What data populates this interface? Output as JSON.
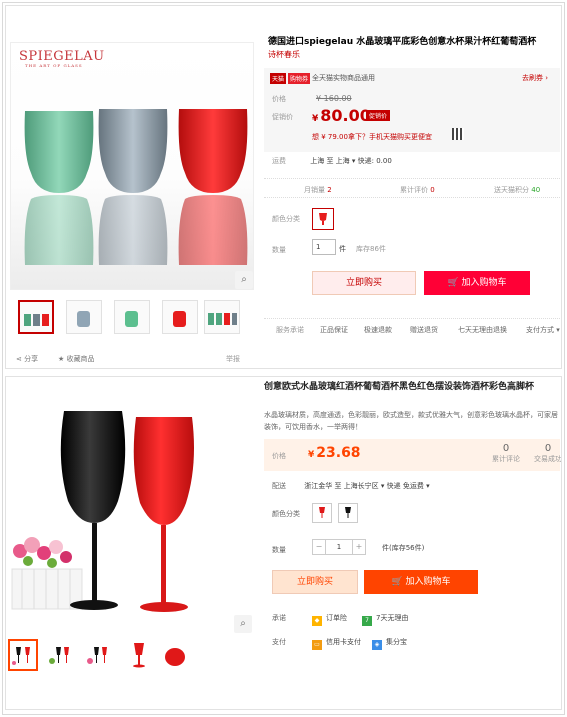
{
  "panel1": {
    "logo": "SPIEGELAU",
    "logo_sub": "THE ART OF GLASS",
    "title": "德国进口spiegelau 水晶玻璃平底彩色创意水杯果汁杯红葡萄酒杯",
    "subtitle": "诗杯春乐",
    "badges": {
      "tmall": "天猫",
      "shop": "购物券"
    },
    "shop_note": "全天猫实物商品通用",
    "coupon_link": "去刷券",
    "price_label": "价格",
    "old_price": "¥ 160.00",
    "promo_label": "促销价",
    "promo_currency": "¥",
    "promo_price": "80.00",
    "promo_tag": "促销价",
    "phone_note": "想 ¥ 79.00拿下？手机天猫购买更便宜",
    "shipping_label": "运费",
    "shipping_text": "上海  至 上海 ▾  快递: 0.00",
    "stats": [
      {
        "label": "月销量",
        "value": "2"
      },
      {
        "label": "累计评价",
        "value": "0"
      },
      {
        "label": "送天猫积分",
        "value": "40"
      }
    ],
    "color_label": "颜色分类",
    "qty_label": "数量",
    "qty_value": "1",
    "qty_unit": "件",
    "stock": "库存86件",
    "buy_label": "立即购买",
    "cart_label": "加入购物车",
    "service_label": "服务承诺",
    "services": [
      "正品保证",
      "极速退款",
      "赠送退货",
      "七天无理由退换"
    ],
    "pay_label": "支付方式 ▾",
    "share_label": "分享",
    "fav_label": "收藏商品",
    "report_label": "举报",
    "colors": {
      "green": "#4fa57f",
      "grey": "#6f7f8a",
      "red": "#e61d1d",
      "accent": "#c40000"
    }
  },
  "panel2": {
    "title": "创意欧式水晶玻璃红酒杯葡萄酒杯黑色红色摆设装饰酒杯彩色高脚杯",
    "desc": "水晶玻璃材质，高度通透，色彩靓丽，欧式造型，款式优雅大气，创意彩色玻璃水晶杯，可家居装饰，可饮用香水，一举两得！",
    "price_label": "价格",
    "currency": "¥",
    "price": "23.68",
    "reviews": {
      "value": "0",
      "label": "累计评论"
    },
    "sales": {
      "value": "0",
      "label": "交易成功"
    },
    "ship_label": "配送",
    "ship_text": "浙江金华 至  上海长宁区 ▾   快递 免运费 ▾",
    "color_label": "颜色分类",
    "qty_label": "数量",
    "qty_value": "1",
    "minus": "−",
    "plus": "+",
    "stock": "件(库存56件)",
    "buy_label": "立即购买",
    "cart_label": "加入购物车",
    "promise_label": "承诺",
    "promises": [
      "订单险",
      "7天无理由"
    ],
    "pay_label": "支付",
    "pays": [
      "信用卡支付",
      "集分宝"
    ],
    "colors": {
      "accent": "#ff4400",
      "black": "#111111",
      "red": "#e01818"
    }
  }
}
